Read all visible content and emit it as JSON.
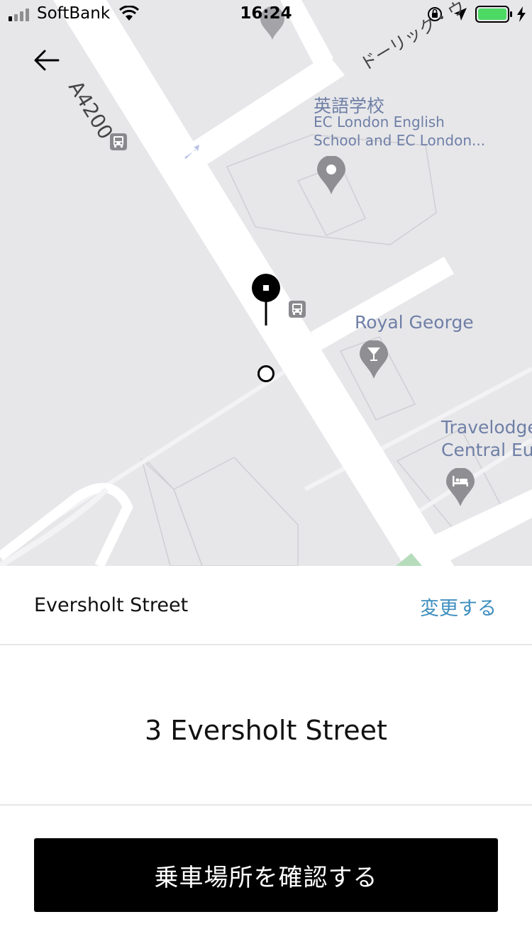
{
  "status_bar": {
    "carrier": "SoftBank",
    "time": "16:24"
  },
  "map": {
    "road_label": "A4200",
    "street_label_top": "ドーリック・ウ",
    "poi_school": {
      "name_jp": "英語学校",
      "name_line1": "EC London English",
      "name_line2": "School and EC London..."
    },
    "poi_pub": {
      "name": "Royal George"
    },
    "poi_hotel": {
      "name_line1": "Travelodge",
      "name_line2": "Central Eus"
    },
    "icons": [
      "back-arrow-icon",
      "bus-stop-icon",
      "location-pin-icon",
      "bar-icon",
      "hotel-icon",
      "pickup-pin-icon",
      "origin-dot-icon"
    ]
  },
  "sheet": {
    "street_name": "Eversholt Street",
    "change_label": "変更する",
    "full_address": "3 Eversholt Street",
    "confirm_label": "乗車場所を確認する"
  },
  "colors": {
    "map_background": "#e7e7ea",
    "road": "#ffffff",
    "poi_label": "#6f7fa6",
    "link": "#3f8fbf",
    "button": "#000000"
  }
}
